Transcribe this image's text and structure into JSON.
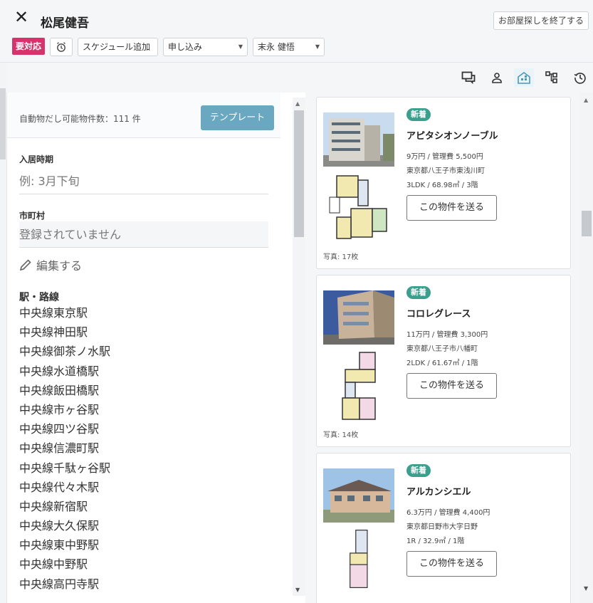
{
  "header": {
    "customer_name": "松尾健吾",
    "end_button": "お部屋探しを終了する",
    "urgent_tag": "要対応",
    "add_schedule": "スケジュール追加",
    "status_select": "申し込み",
    "assignee_select": "末永 健悟"
  },
  "left": {
    "available_count": "自動物だし可能物件数：111 件",
    "template_button": "テンプレート",
    "move_in_label": "入居時期",
    "move_in_placeholder": "例: 3月下旬",
    "city_label": "市町村",
    "city_value": "登録されていません",
    "edit_link": "編集する",
    "stations_label": "駅・路線",
    "stations": [
      "中央線東京駅",
      "中央線神田駅",
      "中央線御茶ノ水駅",
      "中央線水道橋駅",
      "中央線飯田橋駅",
      "中央線市ヶ谷駅",
      "中央線四ツ谷駅",
      "中央線信濃町駅",
      "中央線千駄ヶ谷駅",
      "中央線代々木駅",
      "中央線新宿駅",
      "中央線大久保駅",
      "中央線東中野駅",
      "中央線中野駅",
      "中央線高円寺駅"
    ]
  },
  "properties": [
    {
      "badge": "新着",
      "name": "アピタシオンノーブル",
      "price": "9万円 / 管理費 5,500円",
      "address": "東京都八王子市東浅川町",
      "layout": "3LDK / 68.98㎡ / 3階",
      "send": "この物件を送る",
      "photos": "写真: 17枚"
    },
    {
      "badge": "新着",
      "name": "コロレグレース",
      "price": "11万円 / 管理費 3,300円",
      "address": "東京都八王子市八幡町",
      "layout": "2LDK / 61.67㎡ / 1階",
      "send": "この物件を送る",
      "photos": "写真: 14枚"
    },
    {
      "badge": "新着",
      "name": "アルカンシエル",
      "price": "6.3万円 / 管理費 4,400円",
      "address": "東京都日野市大字日野",
      "layout": "1R / 32.9㎡ / 1階",
      "send": "この物件を送る",
      "photos": ""
    }
  ],
  "colors": {
    "urgent": "#d6336c",
    "template": "#6aa7c0",
    "badge": "#3aa08d"
  }
}
